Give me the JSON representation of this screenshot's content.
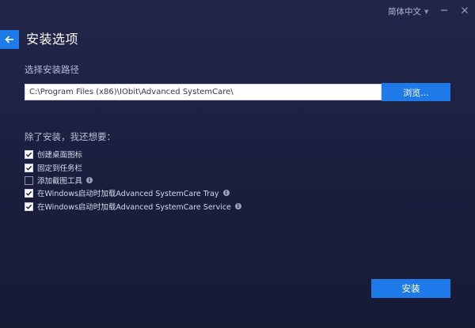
{
  "titlebar": {
    "language": "简体中文",
    "chevron_icon": "chevron-down-icon",
    "minimize_icon": "minimize-icon",
    "close_icon": "close-icon"
  },
  "header": {
    "back_icon": "arrow-left-icon",
    "title": "安装选项"
  },
  "install_path": {
    "label": "选择安装路径",
    "value": "C:\\Program Files (x86)\\IObit\\Advanced SystemCare\\",
    "browse_label": "浏览..."
  },
  "options": {
    "heading": "除了安装，我还想要：",
    "items": [
      {
        "label": "创建桌面图标",
        "checked": true,
        "info": false
      },
      {
        "label": "固定到任务栏",
        "checked": true,
        "info": false
      },
      {
        "label": "添加截图工具",
        "checked": false,
        "info": true
      },
      {
        "label": "在Windows启动时加载Advanced SystemCare Tray",
        "checked": true,
        "info": true
      },
      {
        "label": "在Windows启动时加载Advanced SystemCare Service",
        "checked": true,
        "info": true
      }
    ]
  },
  "footer": {
    "install_label": "安装"
  },
  "colors": {
    "accent": "#1e7ae8",
    "background": "#1c2040",
    "text": "#cfd3e6"
  }
}
